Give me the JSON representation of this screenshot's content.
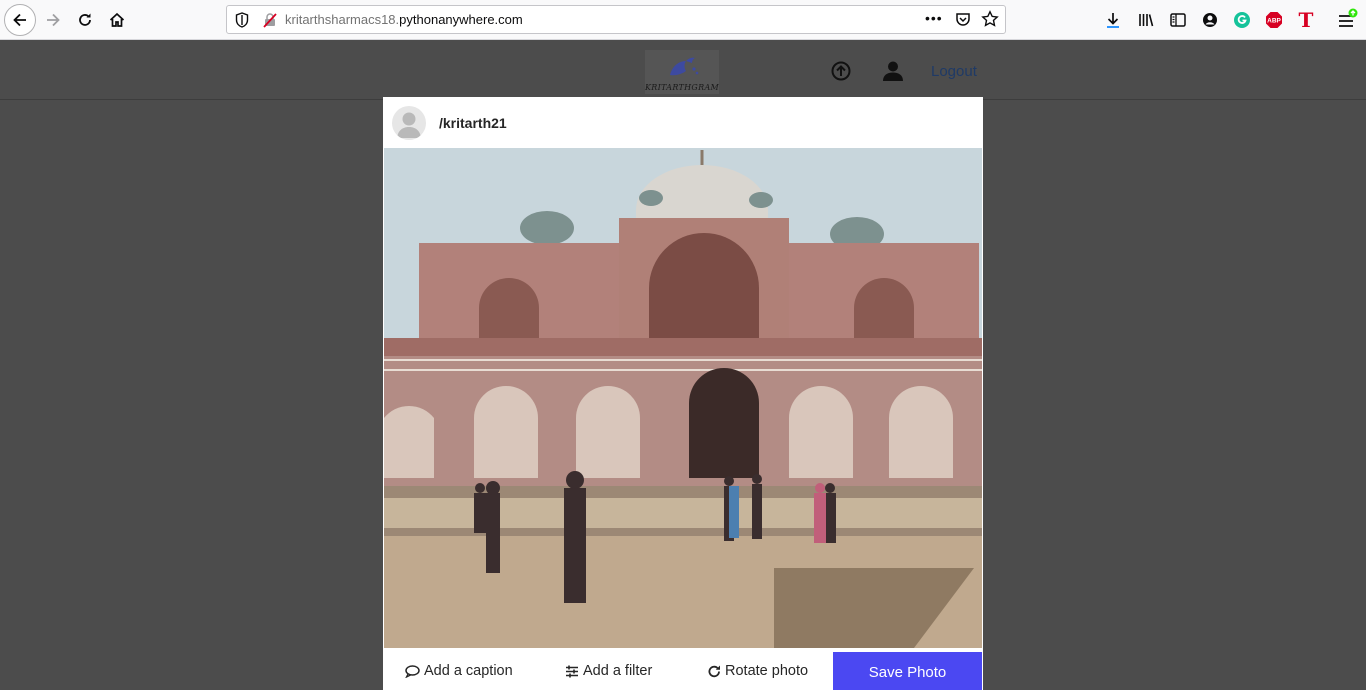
{
  "browser": {
    "url_prefix": "kritarthsharmacs18.",
    "url_domain": "pythonanywhere.com",
    "url_more": "•••",
    "extensions": {
      "abp_label": "ABP",
      "t_label": "T"
    }
  },
  "header": {
    "logo_text": "KRITARTHGRAM",
    "logout_label": "Logout"
  },
  "post": {
    "username": "/kritarth21",
    "actions": {
      "caption_label": "Add a caption",
      "filter_label": "Add a filter",
      "rotate_label": "Rotate photo",
      "save_label": "Save Photo"
    }
  },
  "colors": {
    "accent": "#4b48f2",
    "page_bg": "#4c4c4c",
    "logout": "#1f3a66"
  }
}
